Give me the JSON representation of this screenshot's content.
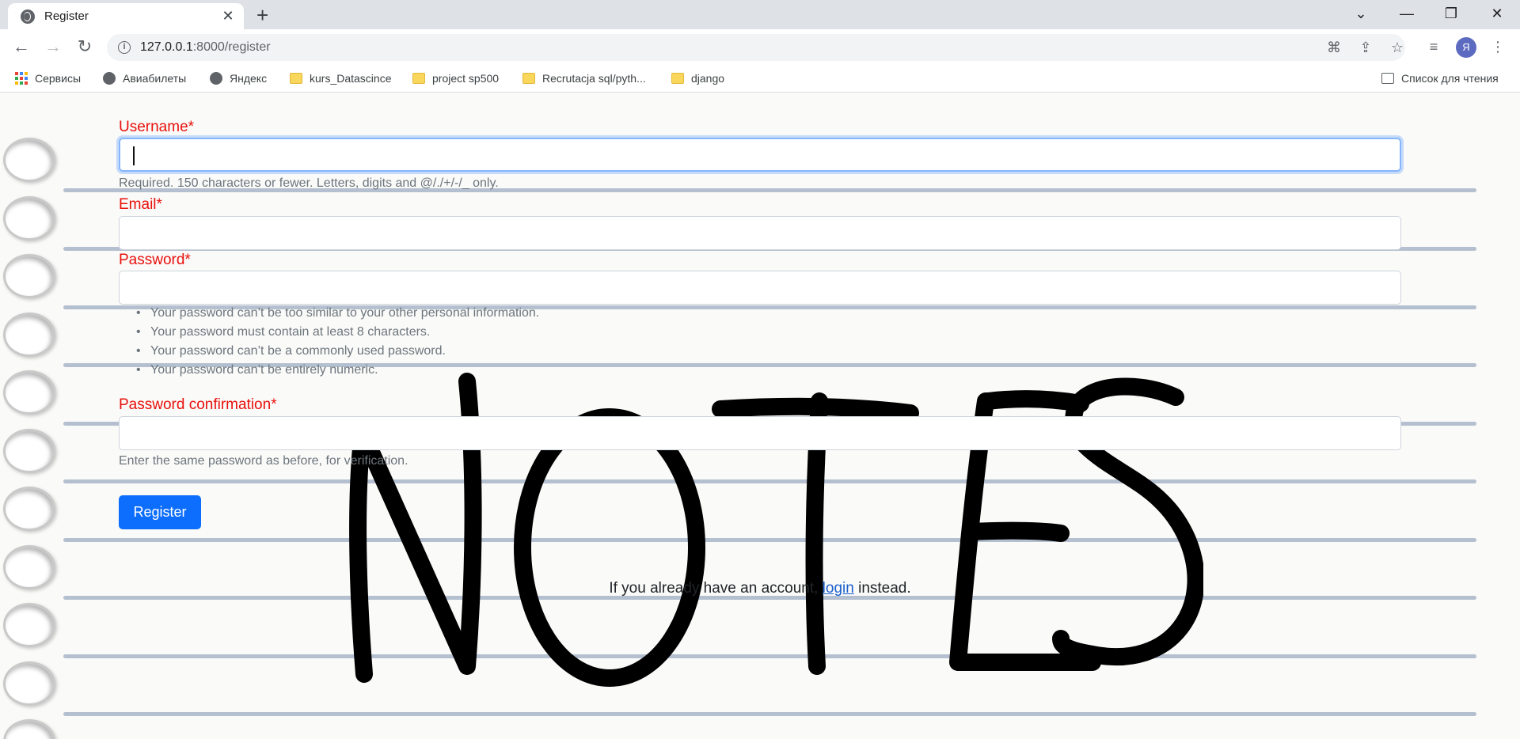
{
  "browser": {
    "tab_title": "Register",
    "url_host": "127.0.0.1",
    "url_path": ":8000/register",
    "bookmarks": [
      {
        "label": "Сервисы",
        "icon": "apps-icon"
      },
      {
        "label": "Авиабилеты",
        "icon": "globe-icon"
      },
      {
        "label": "Яндекс",
        "icon": "globe-icon"
      },
      {
        "label": "kurs_Datascince",
        "icon": "folder-icon"
      },
      {
        "label": "project sp500",
        "icon": "folder-icon"
      },
      {
        "label": "Recrutacja sql/pyth...",
        "icon": "folder-icon"
      },
      {
        "label": "django",
        "icon": "folder-icon"
      }
    ],
    "reading_list": "Список для чтения",
    "avatar_letter": "Я"
  },
  "form": {
    "username_label": "Username*",
    "username_value": "",
    "username_help": "Required. 150 characters or fewer. Letters, digits and @/./+/-/_ only.",
    "email_label": "Email*",
    "email_value": "",
    "password_label": "Password*",
    "password_value": "",
    "password_rules": [
      "Your password can’t be too similar to your other personal information.",
      "Your password must contain at least 8 characters.",
      "Your password can’t be a commonly used password.",
      "Your password can’t be entirely numeric."
    ],
    "password2_label": "Password confirmation*",
    "password2_value": "",
    "password2_help": "Enter the same password as before, for verification.",
    "submit_label": "Register"
  },
  "login_prompt": {
    "before": "If you already have an account,",
    "link": "login",
    "after": "instead."
  },
  "background_art": "NOTES",
  "colors": {
    "label_red": "#e8100c",
    "primary_blue": "#0d6efd",
    "link_blue": "#1a5fcc"
  }
}
